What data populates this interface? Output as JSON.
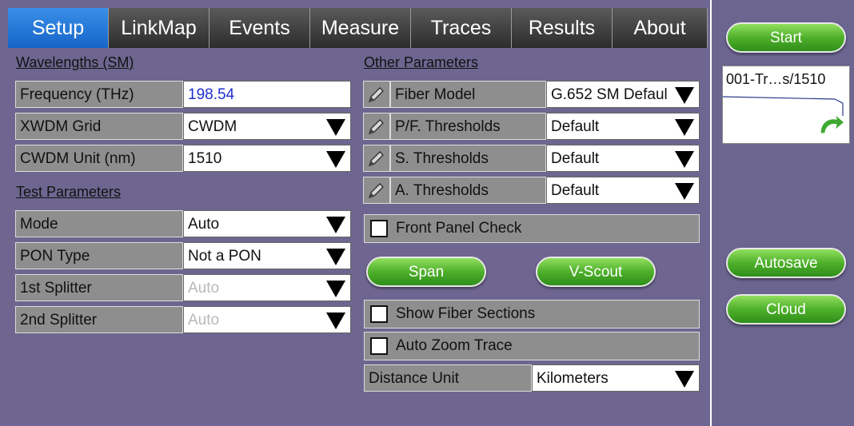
{
  "tabs": [
    "Setup",
    "LinkMap",
    "Events",
    "Measure",
    "Traces",
    "Results",
    "About"
  ],
  "left": {
    "wavelengths_title": "Wavelengths (SM)",
    "frequency": {
      "label": "Frequency (THz)",
      "value": "198.54"
    },
    "xwdm_grid": {
      "label": "XWDM Grid",
      "value": "CWDM"
    },
    "cwdm_unit": {
      "label": "CWDM Unit (nm)",
      "value": "1510"
    },
    "test_params_title": "Test Parameters",
    "mode": {
      "label": "Mode",
      "value": "Auto"
    },
    "pon_type": {
      "label": "PON Type",
      "value": "Not a PON"
    },
    "splitter1": {
      "label": "1st Splitter",
      "value": "Auto"
    },
    "splitter2": {
      "label": "2nd Splitter",
      "value": "Auto"
    }
  },
  "right": {
    "other_params_title": "Other Parameters",
    "fiber_model": {
      "label": "Fiber Model",
      "value": "G.652 SM Defaul"
    },
    "pf_thresholds": {
      "label": "P/F. Thresholds",
      "value": "Default"
    },
    "s_thresholds": {
      "label": "S. Thresholds",
      "value": "Default"
    },
    "a_thresholds": {
      "label": "A. Thresholds",
      "value": "Default"
    },
    "front_panel_check": "Front Panel Check",
    "span_button": "Span",
    "vscout_button": "V-Scout",
    "show_fiber_sections": "Show Fiber Sections",
    "auto_zoom_trace": "Auto Zoom Trace",
    "distance_unit": {
      "label": "Distance Unit",
      "value": "Kilometers"
    }
  },
  "sidebar": {
    "start": "Start",
    "trace_name": "001-Tr…s/1510",
    "autosave": "Autosave",
    "cloud": "Cloud"
  },
  "icons": [
    "pencil-icon",
    "dropdown-arrow-icon",
    "green-arrow-icon",
    "checkbox-icon"
  ]
}
